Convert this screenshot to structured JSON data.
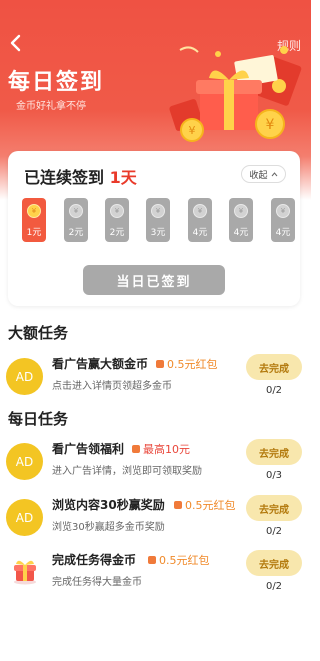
{
  "header": {
    "rules_label": "规则",
    "title": "每日签到",
    "subtitle": "金币好礼拿不停"
  },
  "checkin": {
    "streak_prefix": "已连续签到",
    "streak_count": "1天",
    "collapse_label": "收起",
    "coin_glyph": "¥",
    "days": [
      {
        "amount": "1元",
        "active": true
      },
      {
        "amount": "2元",
        "active": false
      },
      {
        "amount": "2元",
        "active": false
      },
      {
        "amount": "3元",
        "active": false
      },
      {
        "amount": "4元",
        "active": false
      },
      {
        "amount": "4元",
        "active": false
      },
      {
        "amount": "4元",
        "active": false
      }
    ],
    "signed_button": "当日已签到"
  },
  "big_tasks": {
    "title": "大额任务",
    "items": [
      {
        "icon": "AD",
        "name": "看广告赢大额金币",
        "reward": "0.5元红包",
        "desc": "点击进入详情页领超多金币",
        "button": "去完成",
        "progress": "0/2"
      }
    ]
  },
  "daily_tasks": {
    "title": "每日任务",
    "items": [
      {
        "icon": "AD",
        "name": "看广告领福利",
        "reward": "最高10元",
        "desc": "进入广告详情，浏览即可领取奖励",
        "button": "去完成",
        "progress": "0/3"
      },
      {
        "icon": "AD",
        "name": "浏览内容30秒赢奖励",
        "reward": "0.5元红包",
        "desc": "浏览30秒赢超多金币奖励",
        "button": "去完成",
        "progress": "0/2"
      },
      {
        "icon": "gift-icon",
        "name": "完成任务得金币",
        "reward": "0.5元红包",
        "desc": "完成任务得大量金币",
        "button": "去完成",
        "progress": "0/2"
      }
    ]
  },
  "colors": {
    "brand_red": "#ef5243",
    "accent_gold": "#f3c523",
    "reward_orange": "#f08a2a"
  }
}
